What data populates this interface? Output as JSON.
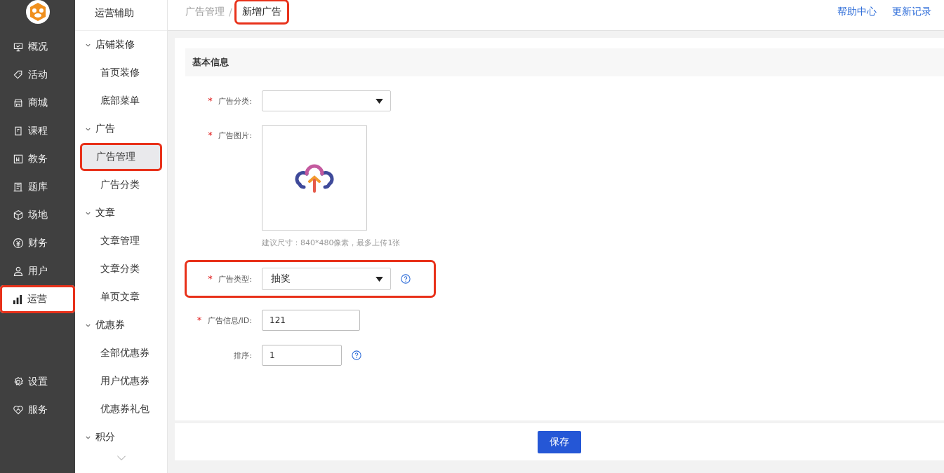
{
  "rail": {
    "items": [
      {
        "label": "概况",
        "selected": false,
        "highlighted": false
      },
      {
        "label": "活动",
        "selected": false,
        "highlighted": false
      },
      {
        "label": "商城",
        "selected": false,
        "highlighted": false
      },
      {
        "label": "课程",
        "selected": false,
        "highlighted": false
      },
      {
        "label": "教务",
        "selected": false,
        "highlighted": false
      },
      {
        "label": "题库",
        "selected": false,
        "highlighted": false
      },
      {
        "label": "场地",
        "selected": false,
        "highlighted": false
      },
      {
        "label": "财务",
        "selected": false,
        "highlighted": false
      },
      {
        "label": "用户",
        "selected": false,
        "highlighted": false
      },
      {
        "label": "运营",
        "selected": true,
        "highlighted": true
      }
    ],
    "bottom_items": [
      {
        "label": "设置"
      },
      {
        "label": "服务"
      }
    ]
  },
  "submenu": {
    "title": "运营辅助",
    "groups": [
      {
        "label": "店铺装修",
        "expanded": true,
        "children": [
          {
            "label": "首页装修",
            "selected": false,
            "highlighted": false
          },
          {
            "label": "底部菜单",
            "selected": false,
            "highlighted": false
          }
        ]
      },
      {
        "label": "广告",
        "expanded": true,
        "children": [
          {
            "label": "广告管理",
            "selected": true,
            "highlighted": true
          },
          {
            "label": "广告分类",
            "selected": false,
            "highlighted": false
          }
        ]
      },
      {
        "label": "文章",
        "expanded": true,
        "children": [
          {
            "label": "文章管理",
            "selected": false,
            "highlighted": false
          },
          {
            "label": "文章分类",
            "selected": false,
            "highlighted": false
          },
          {
            "label": "单页文章",
            "selected": false,
            "highlighted": false
          }
        ]
      },
      {
        "label": "优惠券",
        "expanded": true,
        "children": [
          {
            "label": "全部优惠券",
            "selected": false,
            "highlighted": false
          },
          {
            "label": "用户优惠券",
            "selected": false,
            "highlighted": false
          },
          {
            "label": "优惠券礼包",
            "selected": false,
            "highlighted": false
          }
        ]
      },
      {
        "label": "积分",
        "expanded": true
      }
    ]
  },
  "breadcrumb_separator": "/",
  "required_mark": "*",
  "breadcrumb": [
    {
      "label": "广告管理",
      "highlighted": false
    },
    {
      "label": "新增广告",
      "highlighted": true
    }
  ],
  "top_links": [
    "帮助中心",
    "更新记录"
  ],
  "section_title": "基本信息",
  "fields": [
    {
      "kind": "select",
      "label": "广告分类:",
      "required": true,
      "help": false,
      "highlighted": false
    },
    {
      "kind": "upload",
      "label": "广告图片:",
      "required": true,
      "hint": "建议尺寸：840*480像素，最多上传1张",
      "help": false,
      "highlighted": false
    },
    {
      "kind": "select",
      "label": "广告类型:",
      "required": true,
      "value": "抽奖",
      "help": true,
      "highlighted": true
    },
    {
      "kind": "input",
      "label": "广告信息/ID:",
      "required": true,
      "value": "121",
      "help": false,
      "highlighted": false
    },
    {
      "kind": "short_input",
      "label": "排序:",
      "required": false,
      "value": "1",
      "help": true,
      "highlighted": false
    }
  ],
  "save_button": "保存"
}
